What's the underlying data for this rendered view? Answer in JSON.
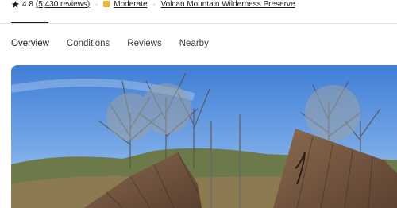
{
  "trail_meta": {
    "rating": "4.8",
    "reviews": "(5,430 reviews)",
    "separator": "·",
    "difficulty": "Moderate",
    "park": "Volcan Mountain Wilderness Preserve",
    "icons": {
      "rating": "star-icon",
      "difficulty": "difficulty-square-icon"
    },
    "colors": {
      "difficulty": "#f0b429"
    }
  },
  "tabs": [
    {
      "label": "Overview",
      "active": true
    },
    {
      "label": "Conditions",
      "active": false
    },
    {
      "label": "Reviews",
      "active": false
    },
    {
      "label": "Nearby",
      "active": false
    }
  ],
  "hero": {
    "description_icon": "trail-photo",
    "accent_color": "#1a1a1a"
  }
}
